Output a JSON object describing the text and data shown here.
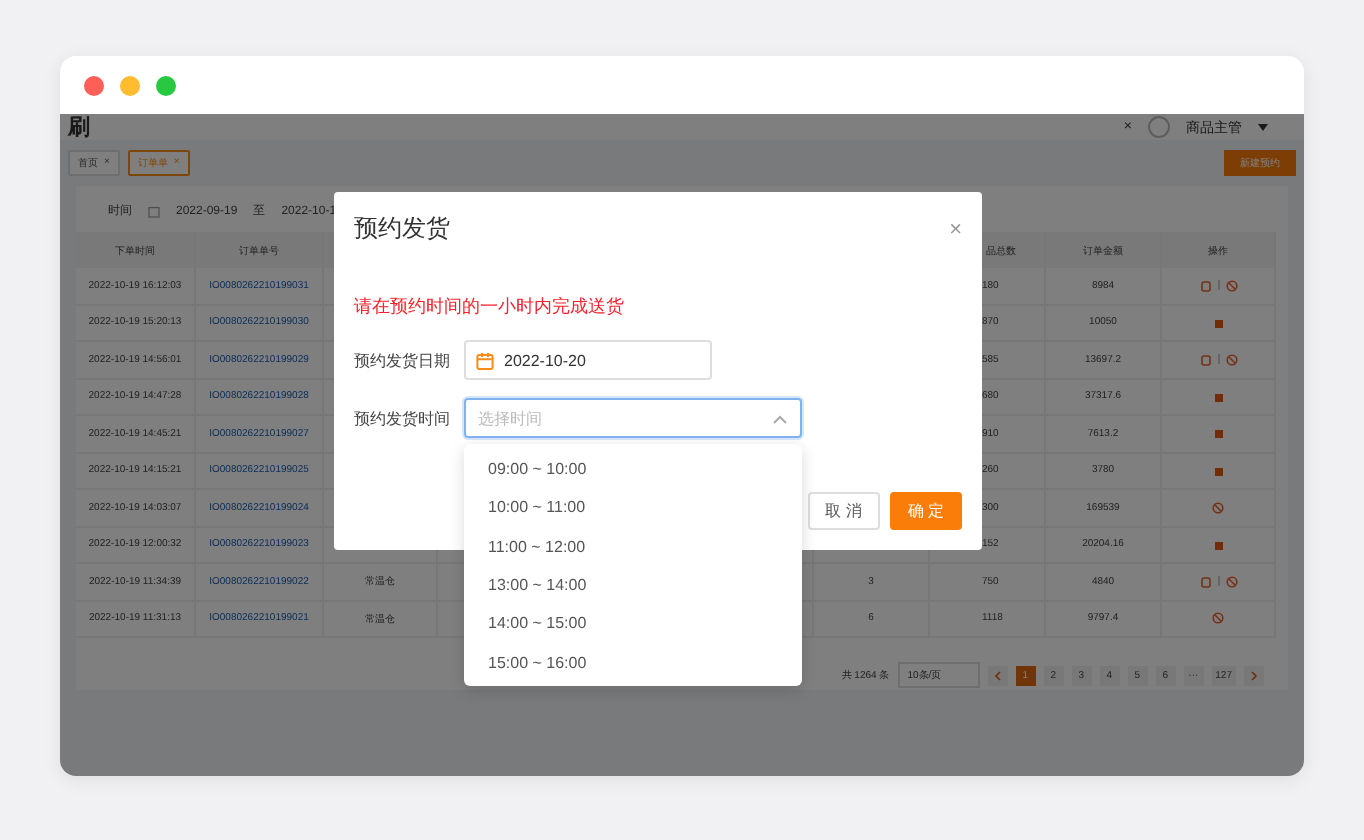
{
  "window": {
    "traffic_lights": [
      {
        "color": "#ff5f57"
      },
      {
        "color": "#febc2e"
      },
      {
        "color": "#28c840"
      }
    ]
  },
  "app": {
    "logo": "刷",
    "top_close": "×",
    "user": "商品主管",
    "tags": [
      {
        "label": "首页",
        "close": "×",
        "selected": false
      },
      {
        "label": "订单单",
        "close": "×",
        "selected": true
      }
    ],
    "action_button": "新建预约",
    "filter": {
      "label": "时间",
      "start": "2022-09-19",
      "separator": "至",
      "end": "2022-10-1"
    }
  },
  "table": {
    "columns": {
      "order_time": "下单时间",
      "order_no": "订单单号",
      "column_6": "品总数",
      "amount": "订单金额",
      "actions": "操作"
    },
    "rows": [
      {
        "order_time": "2022-10-19 16:12:03",
        "order_no": "IO0080262210199031",
        "column_6": "180",
        "amount": "8984",
        "actions": {
          "kind": "clock_cancel"
        }
      },
      {
        "order_time": "2022-10-19 15:20:13",
        "order_no": "IO0080262210199030",
        "column_6": "870",
        "amount": "10050",
        "actions": {
          "kind": "delete"
        }
      },
      {
        "order_time": "2022-10-19 14:56:01",
        "order_no": "IO0080262210199029",
        "column_6": "585",
        "amount": "13697.2",
        "actions": {
          "kind": "clock_cancel"
        }
      },
      {
        "order_time": "2022-10-19 14:47:28",
        "order_no": "IO0080262210199028",
        "column_6": "680",
        "amount": "37317.6",
        "actions": {
          "kind": "delete"
        }
      },
      {
        "order_time": "2022-10-19 14:45:21",
        "order_no": "IO0080262210199027",
        "column_6": "910",
        "amount": "7613.2",
        "actions": {
          "kind": "delete"
        }
      },
      {
        "order_time": "2022-10-19 14:15:21",
        "order_no": "IO0080262210199025",
        "column_6": "260",
        "amount": "3780",
        "actions": {
          "kind": "delete"
        }
      },
      {
        "order_time": "2022-10-19 14:03:07",
        "order_no": "IO0080262210199024",
        "column_6": "300",
        "amount": "169539",
        "actions": {
          "kind": "cancel"
        }
      },
      {
        "order_time": "2022-10-19 12:00:32",
        "order_no": "IO0080262210199023",
        "column_6": "152",
        "amount": "20204.16",
        "actions": {
          "kind": "delete"
        }
      },
      {
        "order_time": "2022-10-19 11:34:39",
        "order_no": "IO0080262210199022",
        "column_3": "常温仓",
        "column_4": "3",
        "column_6": "750",
        "amount": "4840",
        "actions": {
          "kind": "clock_cancel"
        }
      },
      {
        "order_time": "2022-10-19 11:31:13",
        "order_no": "IO0080262210199021",
        "column_3": "常温仓",
        "column_4": "6",
        "column_6": "1118",
        "amount": "9797.4",
        "actions": {
          "kind": "cancel"
        }
      }
    ]
  },
  "pagination": {
    "total": "共 1264 条",
    "page_size": "10条/页",
    "pages": [
      {
        "label": "1",
        "selected": true
      },
      {
        "label": "2",
        "selected": false
      },
      {
        "label": "3",
        "selected": false
      },
      {
        "label": "4",
        "selected": false
      },
      {
        "label": "5",
        "selected": false
      },
      {
        "label": "6",
        "selected": false
      },
      {
        "label": "···",
        "selected": false
      },
      {
        "label": "127",
        "selected": false
      }
    ]
  },
  "modal": {
    "title": "预约发货",
    "close": "×",
    "notice": "请在预约时间的一小时内完成送货",
    "fields": [
      {
        "kind": "date",
        "label": "预约发货日期",
        "value": "2022-10-20"
      },
      {
        "kind": "select",
        "label": "预约发货时间",
        "placeholder": "选择时间",
        "expanded": true
      }
    ],
    "buttons": [
      {
        "label": "取 消",
        "primary": false
      },
      {
        "label": "确 定",
        "primary": true
      }
    ],
    "options": [
      "09:00 ~ 10:00",
      "10:00 ~ 11:00",
      "11:00 ~ 12:00",
      "13:00 ~ 14:00",
      "14:00 ~ 15:00",
      "15:00 ~ 16:00"
    ]
  }
}
